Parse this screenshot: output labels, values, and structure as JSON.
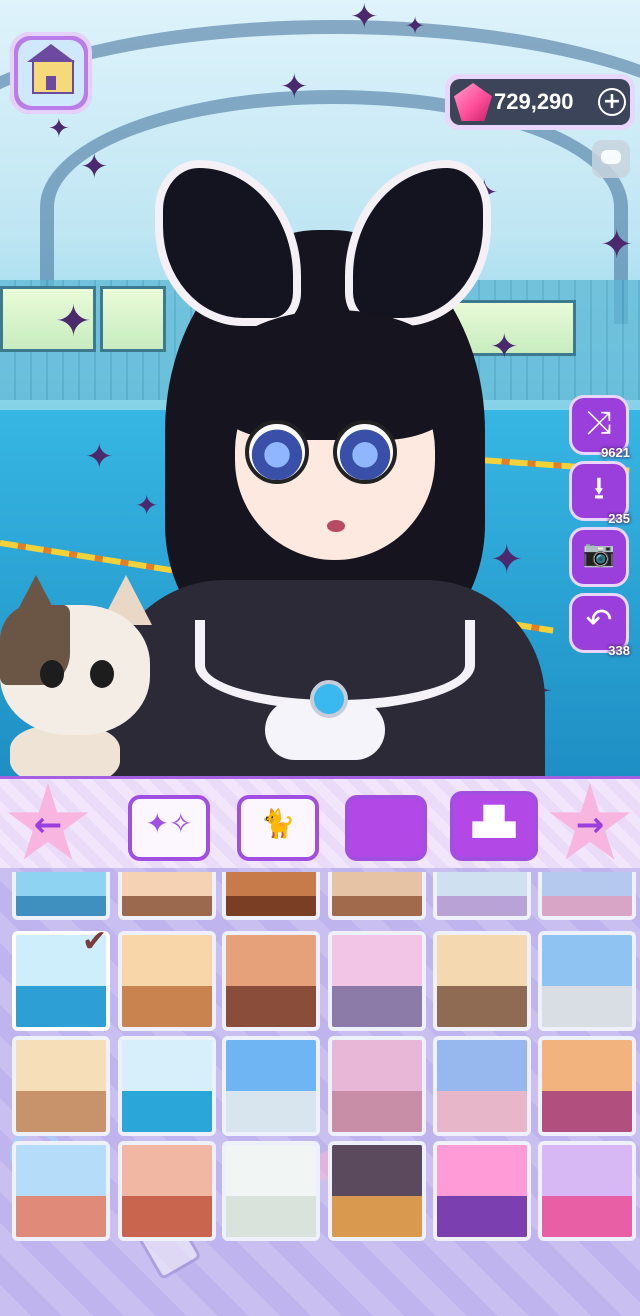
{
  "currency": {
    "amount": "729,290"
  },
  "side_actions": [
    {
      "icon": "shuffle-icon",
      "glyph": "⤨",
      "count": "9621"
    },
    {
      "icon": "download-icon",
      "glyph": "⭳",
      "count": "235"
    },
    {
      "icon": "camera-icon",
      "glyph": "📷",
      "count": ""
    },
    {
      "icon": "undo-icon",
      "glyph": "↶",
      "count": "338"
    }
  ],
  "category_bar": {
    "prev_glyph": "←",
    "next_glyph": "→",
    "tabs": [
      {
        "icon": "sparkles-pattern-icon",
        "glyph": "✦✧",
        "selected": false
      },
      {
        "icon": "cat-frame-icon",
        "glyph": "🐈",
        "selected": false
      },
      {
        "icon": "blank-color-icon",
        "glyph": "",
        "selected": false
      },
      {
        "icon": "city-background-icon",
        "glyph": "▟▙",
        "selected": true
      }
    ]
  },
  "backgrounds": [
    "seaside",
    "classroom",
    "shrine-hall",
    "theater",
    "park-path",
    "street",
    "indoor-pool",
    "sunset-classroom",
    "cozy-room",
    "cherry-blossom-crossing",
    "lab-classroom",
    "school-exterior",
    "hallway",
    "pool-hall",
    "school-sky",
    "pink-building",
    "ferris-wheel-park",
    "carnival-night",
    "amusement-gate",
    "circus-gate",
    "bright-corridor",
    "night-alley",
    "concert-stage",
    "pink-stage"
  ],
  "selected_background_index": 6,
  "colors": {
    "accent": "#a14fe0",
    "panel": "#c6bdf0",
    "gem": "#ff4f9a"
  }
}
